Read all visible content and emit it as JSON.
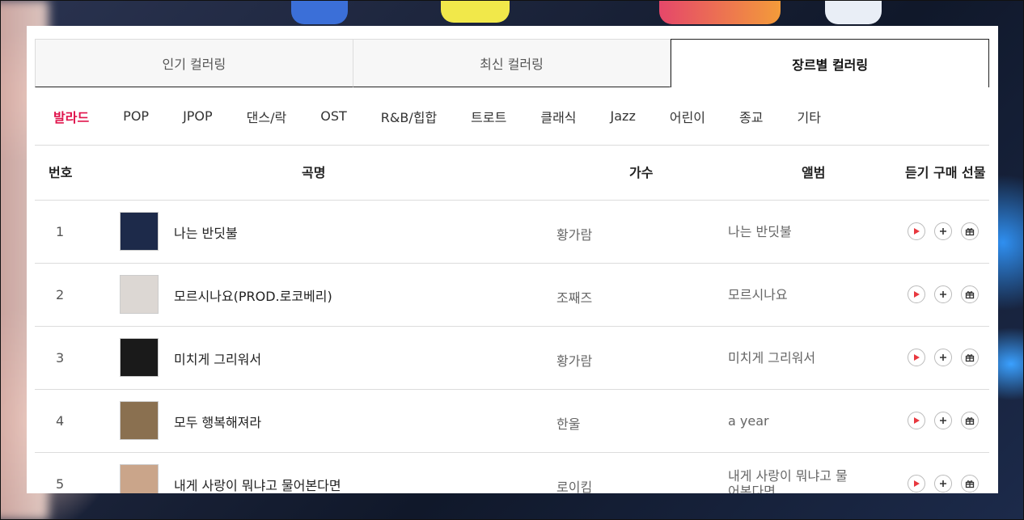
{
  "tabs": [
    {
      "label": "인기 컬러링",
      "active": false
    },
    {
      "label": "최신 컬러링",
      "active": false
    },
    {
      "label": "장르별 컬러링",
      "active": true
    }
  ],
  "genres": [
    {
      "label": "발라드",
      "active": true
    },
    {
      "label": "POP"
    },
    {
      "label": "JPOP"
    },
    {
      "label": "댄스/락"
    },
    {
      "label": "OST"
    },
    {
      "label": "R&B/힙합"
    },
    {
      "label": "트로트"
    },
    {
      "label": "클래식"
    },
    {
      "label": "Jazz"
    },
    {
      "label": "어린이"
    },
    {
      "label": "종교"
    },
    {
      "label": "기타"
    }
  ],
  "table": {
    "headers": {
      "num": "번호",
      "title": "곡명",
      "artist": "가수",
      "album": "앨범",
      "actions": "듣기 구매 선물"
    },
    "rows": [
      {
        "num": "1",
        "title": "나는 반딧불",
        "artist": "황가람",
        "album": "나는 반딧불",
        "thumb_color": "#1d2a4a"
      },
      {
        "num": "2",
        "title": "모르시나요(PROD.로코베리)",
        "artist": "조째즈",
        "album": "모르시나요",
        "thumb_color": "#dcd7d3"
      },
      {
        "num": "3",
        "title": "미치게 그리워서",
        "artist": "황가람",
        "album": "미치게 그리워서",
        "thumb_color": "#1a1a1a"
      },
      {
        "num": "4",
        "title": "모두 행복해져라",
        "artist": "한울",
        "album": "a year",
        "thumb_color": "#8a7050"
      },
      {
        "num": "5",
        "title": "내게 사랑이 뭐냐고 물어본다면",
        "artist": "로이킴",
        "album": "내게 사랑이 뭐냐고 물어본다면",
        "thumb_color": "#caa58a"
      }
    ]
  },
  "icons": {
    "play": "play-icon",
    "add": "plus-icon",
    "gift": "gift-icon"
  },
  "colors": {
    "accent": "#e0144c",
    "play": "#e8383f"
  }
}
